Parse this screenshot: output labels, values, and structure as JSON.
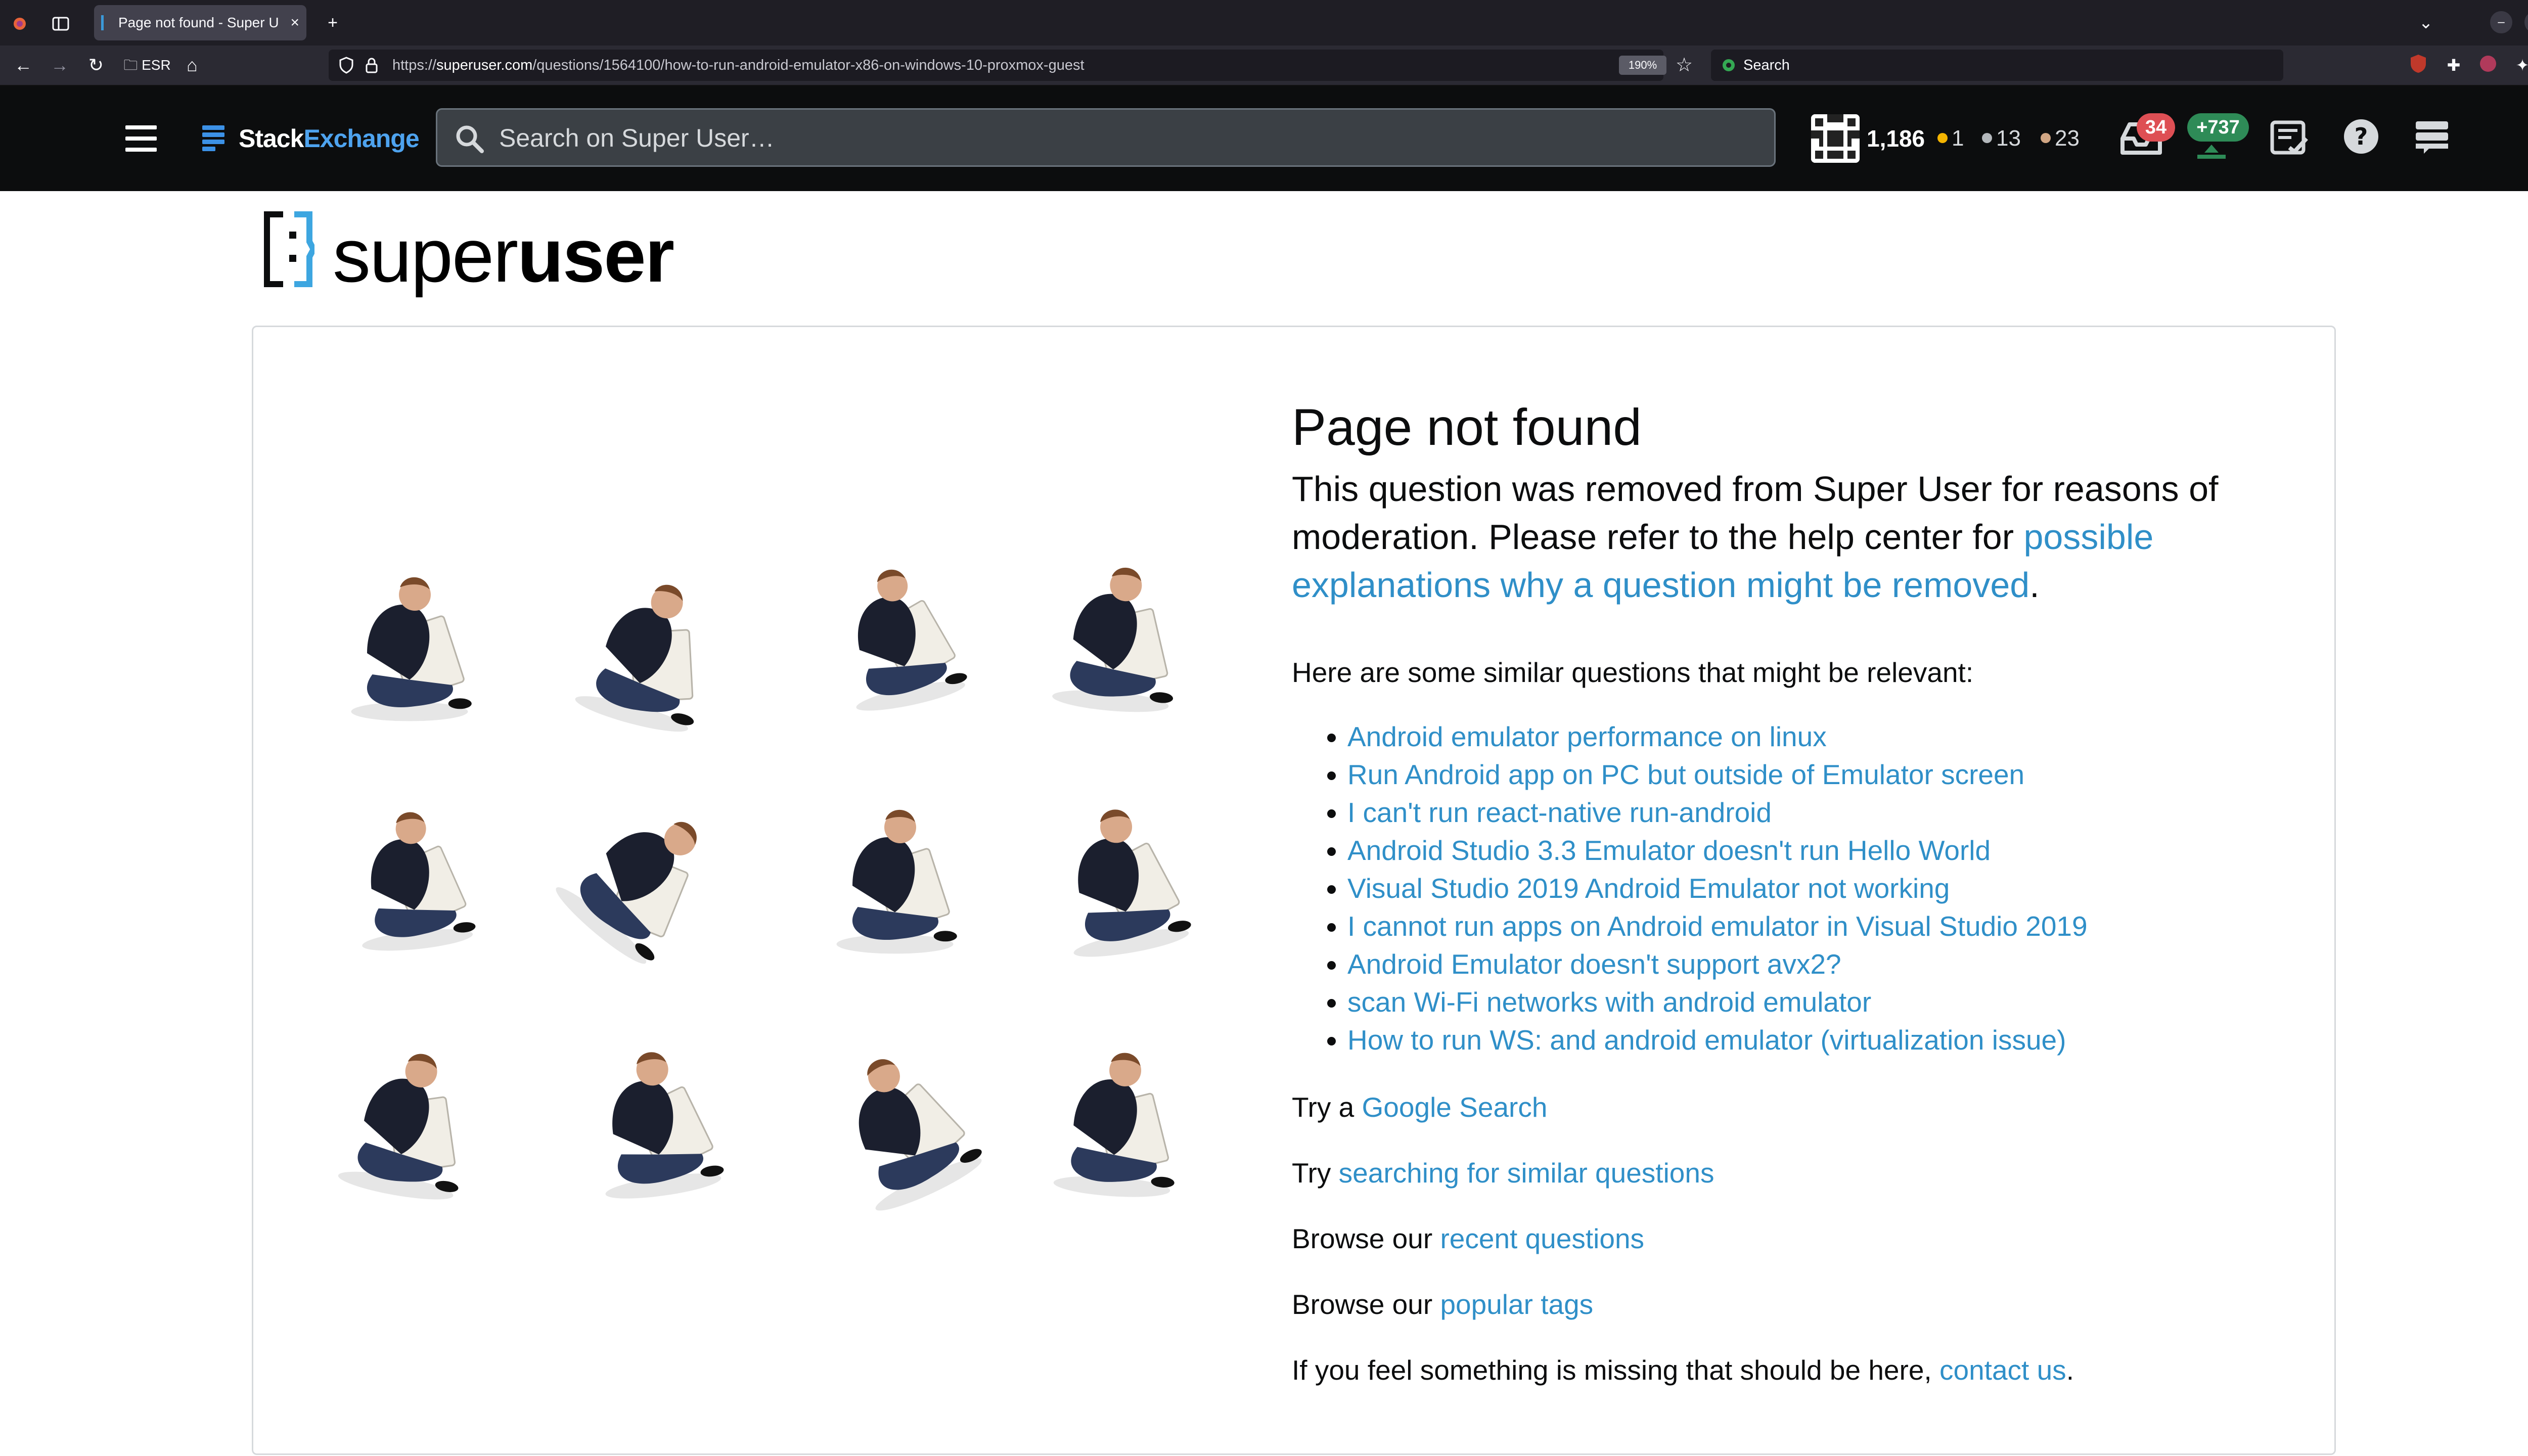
{
  "browser": {
    "tab_title": "Page not found - Super U",
    "new_tab_glyph": "+",
    "bookmark_label": "ESR",
    "url_prefix": "https://",
    "url_host": "superuser.com",
    "url_path": "/questions/1564100/how-to-run-android-emulator-x86-on-windows-10-proxmox-guest",
    "zoom": "190%",
    "search_placeholder": "Search"
  },
  "topbar": {
    "brand_a": "Stack",
    "brand_b": "Exchange",
    "search_placeholder": "Search on Super User…",
    "reputation": "1,186",
    "gold_badges": "1",
    "silver_badges": "13",
    "bronze_badges": "23",
    "inbox_count": "34",
    "achievements": "+737",
    "colors": {
      "gold": "#f4b400",
      "silver": "#b4b8bc",
      "bronze": "#d1a684",
      "inbox": "#de4f54",
      "achievements": "#2e8b57"
    }
  },
  "site": {
    "logo_light": "super",
    "logo_bold": "user"
  },
  "page": {
    "heading": "Page not found",
    "lead_text": "This question was removed from Super User for reasons of moderation. Please refer to the help center for ",
    "lead_link": "possible explanations why a question might be removed",
    "lead_end": ".",
    "similar_intro": "Here are some similar questions that might be relevant:",
    "similar_questions": [
      "Android emulator performance on linux",
      "Run Android app on PC but outside of Emulator screen",
      "I can't run react-native run-android",
      "Android Studio 3.3 Emulator doesn't run Hello World",
      "Visual Studio 2019 Android Emulator not working",
      "I cannot run apps on Android emulator in Visual Studio 2019",
      "Android Emulator doesn't support avx2?",
      "scan Wi-Fi networks with android emulator",
      "How to run WS: and android emulator (virtualization issue)"
    ],
    "google_prefix": "Try a ",
    "google_link": "Google Search",
    "similar_prefix": "Try ",
    "similar_link": "searching for similar questions",
    "recent_prefix": "Browse our ",
    "recent_link": "recent questions",
    "tags_prefix": "Browse our ",
    "tags_link": "popular tags",
    "contact_prefix": "If you feel something is missing that should be here, ",
    "contact_link": "contact us",
    "contact_end": "."
  }
}
